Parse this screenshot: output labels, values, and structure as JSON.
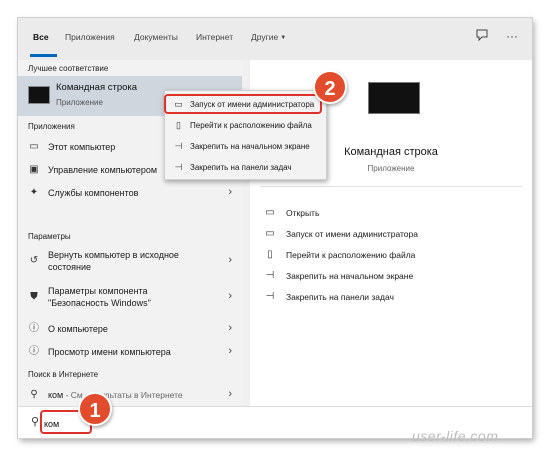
{
  "tabs": [
    {
      "label": "Все"
    },
    {
      "label": "Приложения"
    },
    {
      "label": "Документы"
    },
    {
      "label": "Интернет"
    },
    {
      "label": "Другие"
    }
  ],
  "left": {
    "best_match_header": "Лучшее соответствие",
    "best_match": {
      "title": "Командная строка",
      "subtitle": "Приложение"
    },
    "apps_header": "Приложения",
    "apps": [
      {
        "label": "Этот компьютер",
        "icon": "computer-icon"
      },
      {
        "label": "Управление компьютером",
        "icon": "computer-management-icon"
      },
      {
        "label": "Службы компонентов",
        "icon": "component-services-icon"
      }
    ],
    "settings_header": "Параметры",
    "settings": [
      {
        "line1": "Вернуть компьютер в исходное",
        "line2": "состояние",
        "icon": "reset-icon"
      },
      {
        "line1": "Параметры компонента",
        "line2": "\"Безопасность Windows\"",
        "icon": "shield-icon"
      },
      {
        "label": "О компьютере",
        "icon": "info-icon"
      },
      {
        "label": "Просмотр имени компьютера",
        "icon": "info-icon"
      }
    ],
    "web_header": "Поиск в Интернете",
    "web": {
      "query": "ком",
      "hint": " - См. результаты в Интернете",
      "icon": "search-icon"
    }
  },
  "context_menu": [
    {
      "label": "Запуск от имени администратора",
      "icon": "admin-run-icon"
    },
    {
      "label": "Перейти к расположению файла",
      "icon": "file-location-icon"
    },
    {
      "label": "Закрепить на начальном экране",
      "icon": "pin-icon"
    },
    {
      "label": "Закрепить на панели задач",
      "icon": "pin-icon"
    }
  ],
  "right": {
    "title": "Командная строка",
    "subtitle": "Приложение",
    "actions": [
      {
        "label": "Открыть",
        "icon": "open-icon"
      },
      {
        "label": "Запуск от имени администратора",
        "icon": "admin-run-icon"
      },
      {
        "label": "Перейти к расположению файла",
        "icon": "file-location-icon"
      },
      {
        "label": "Закрепить на начальном экране",
        "icon": "pin-icon"
      },
      {
        "label": "Закрепить на панели задач",
        "icon": "pin-icon"
      }
    ]
  },
  "search": {
    "value": "ком"
  },
  "badges": {
    "one": "1",
    "two": "2"
  },
  "watermark": "user-life.com",
  "colors": {
    "accent": "#0067c0",
    "highlight": "#e0302a",
    "badge": "#e24b2c",
    "selected_row": "#cfd6de"
  }
}
